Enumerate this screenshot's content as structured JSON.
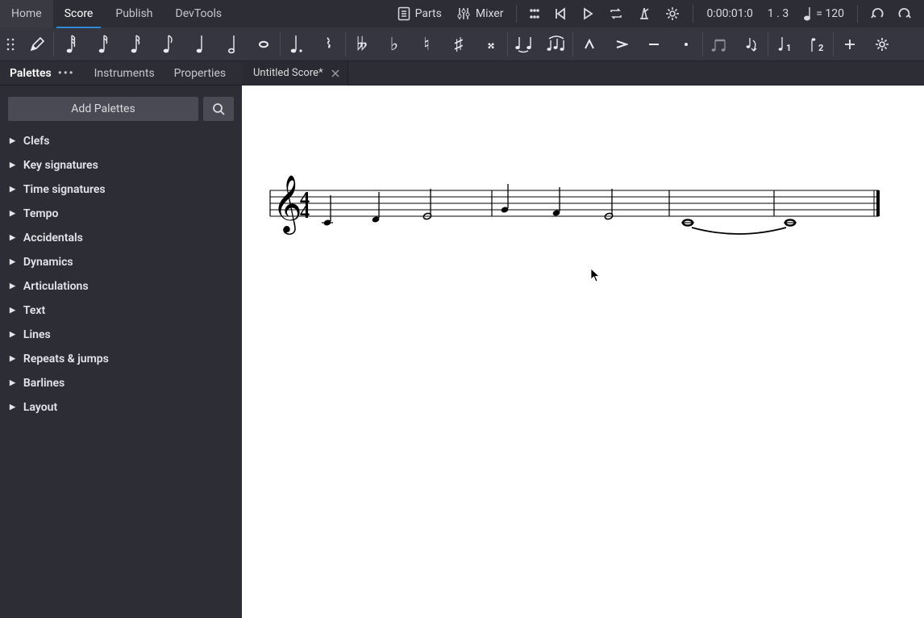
{
  "top_tabs": [
    "Home",
    "Score",
    "Publish",
    "DevTools"
  ],
  "active_top_tab": 1,
  "parts_label": "Parts",
  "mixer_label": "Mixer",
  "time_readout": "0:00:01:0",
  "beat_readout": "1 . 3",
  "tempo_text": "= 120",
  "sidebar_tabs": [
    "Palettes",
    "Instruments",
    "Properties"
  ],
  "active_sidebar_tab": 0,
  "doc_tab": "Untitled Score*",
  "add_palettes_label": "Add Palettes",
  "palettes": [
    "Clefs",
    "Key signatures",
    "Time signatures",
    "Tempo",
    "Accidentals",
    "Dynamics",
    "Articulations",
    "Text",
    "Lines",
    "Repeats & jumps",
    "Barlines",
    "Layout"
  ],
  "note_icons": [
    "grip",
    "edit",
    "32nd",
    "16th",
    "8th",
    "quarter",
    "half",
    "whole"
  ],
  "score": {
    "clef": "treble",
    "time_sig": "4/4",
    "measures": 4,
    "measure_content": [
      [
        "quarter C4",
        "quarter D4",
        "half E4"
      ],
      [
        "quarter G4",
        "quarter F4",
        "half E4"
      ],
      [
        "whole C4 (tie start)"
      ],
      [
        "whole C4 (tie end)"
      ]
    ]
  }
}
